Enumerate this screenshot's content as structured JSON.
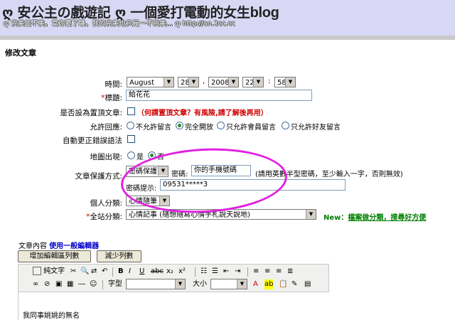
{
  "banner": {
    "title_icon": "ღ",
    "title_cjk": "安公主の戲遊記",
    "title_icon2": "ღ",
    "title_cjk2": "一個愛打電動的女生",
    "title_en": "blog",
    "subtitle_icon": "ღ",
    "subtitle": "完美並不美，當你要了謙，我的完美也只是一不完美...",
    "subtitle_icon2": "ღ",
    "url": "http://an.3cc.cc"
  },
  "page_heading": "修改文章",
  "form": {
    "time": {
      "label": "時間:",
      "month": "August",
      "day": "28",
      "year_sep": ",",
      "year": "2008",
      "hour": "22",
      "colon": ":",
      "minute": "58"
    },
    "title": {
      "star": "*",
      "label": "標題:",
      "value": "給花花"
    },
    "pin": {
      "label": "是否設為置頂文章:",
      "note": "（何謂置頂文章？有風險,請了解後再用）"
    },
    "reply": {
      "label": "允許回應:",
      "options": [
        "不允許留言",
        "完全開放",
        "只允許會員留言",
        "只允許好友留言"
      ],
      "selected": "完全開放"
    },
    "autocorrect": {
      "label": "自動更正錯誤語法"
    },
    "map": {
      "label": "地圖出現:",
      "options": [
        "是",
        "否"
      ],
      "selected": "否"
    },
    "protect": {
      "label": "文章保護方式:",
      "mode": "密碼保護",
      "pw_label": "密碼:",
      "pw_value": "你的手機號碼",
      "pw_note": "(請用英數半型密碼，至少輸入一字，否則無效)",
      "hint_label": "密碼提示:",
      "hint_value": "09531*****3"
    },
    "personal_category": {
      "label": "個人分類:",
      "value": "心情隨筆"
    },
    "site_category": {
      "star": "*",
      "label": "全站分類:",
      "value": "心情記事 (隨想隨寫心情手札說天說地)",
      "new_tag": "New：",
      "new_link": "檔案做分類，搜尋好方便"
    }
  },
  "content": {
    "label": "文章內容",
    "editor_link": "使用一般編輯器",
    "add_rows_button": "增加編輯區列數",
    "remove_rows_button": "減少列數",
    "source_button": "純文字",
    "font_label": "字型",
    "size_label": "大小",
    "body_text": "我同事姚姚的無名"
  },
  "colors": {
    "banner_bg": "#d8d8f4",
    "required_star": "#d00000",
    "new_green": "#008000",
    "annotation": "#e020e0"
  }
}
